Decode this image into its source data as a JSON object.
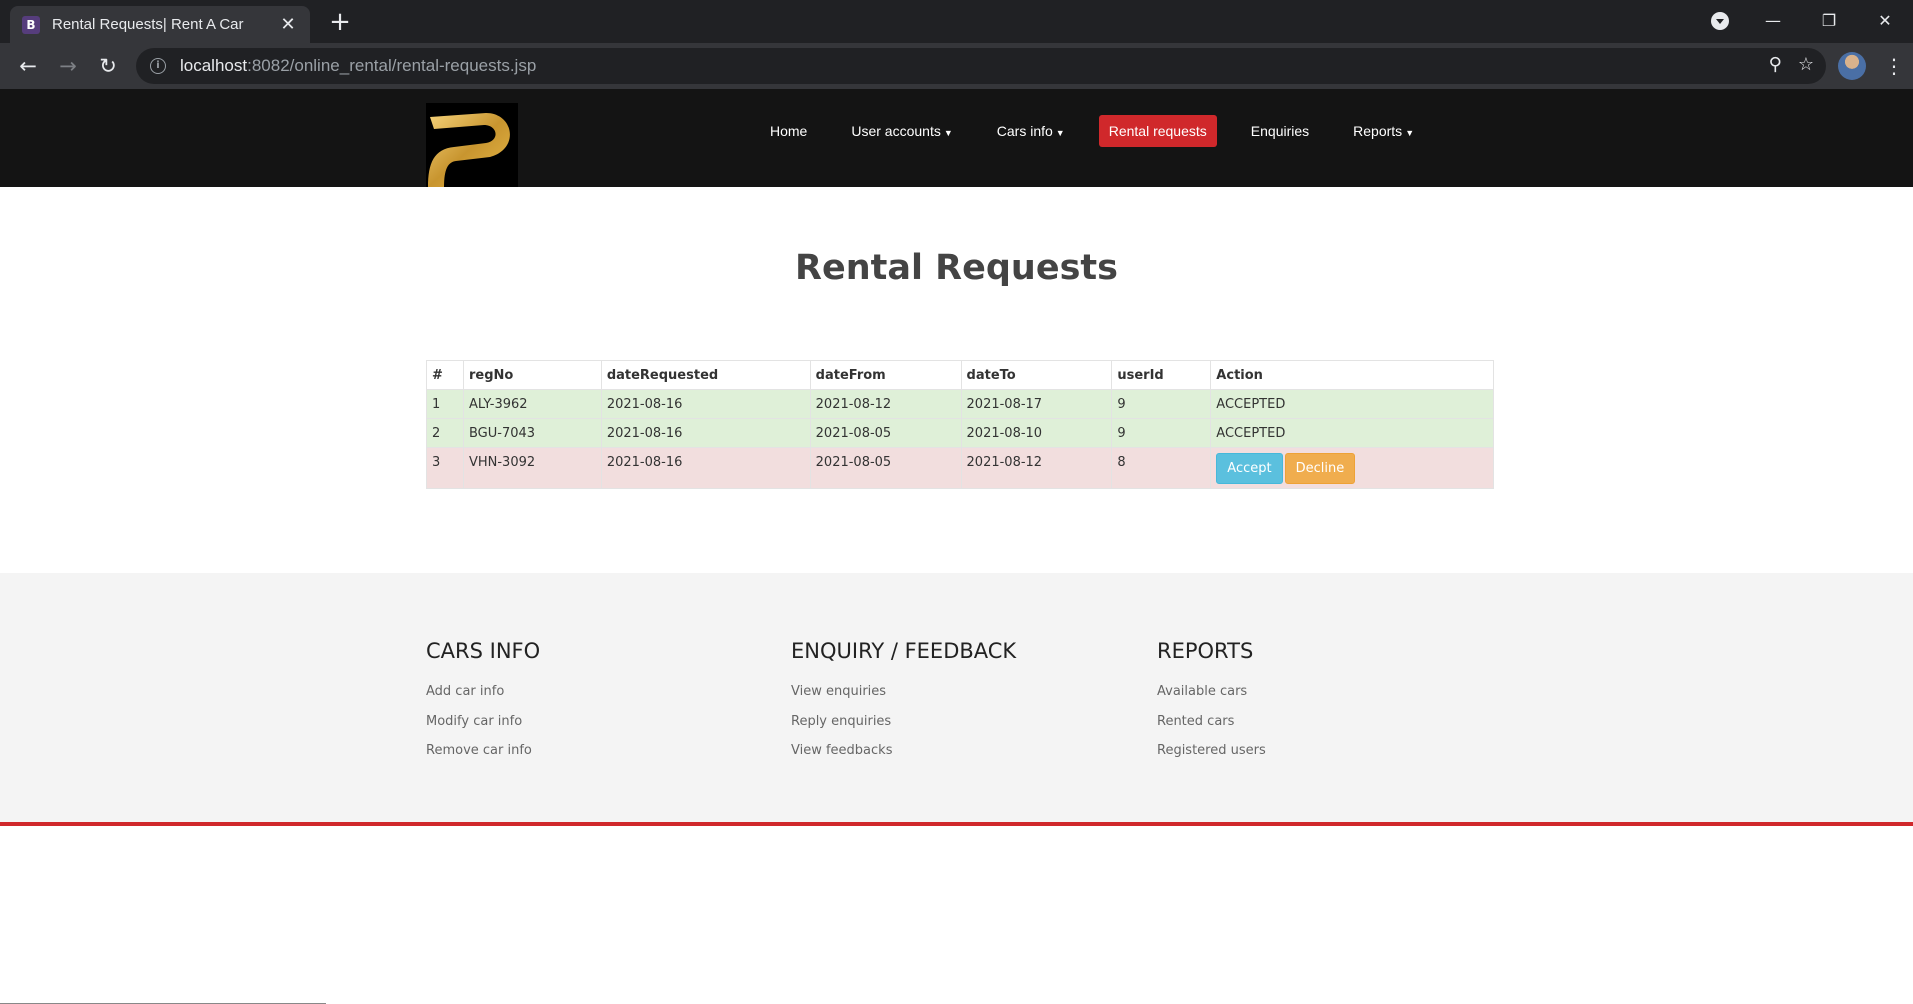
{
  "browser": {
    "tab_title": "Rental Requests| Rent A Car",
    "favicon_letter": "B",
    "url_host": "localhost",
    "url_path": ":8082/online_rental/rental-requests.jsp"
  },
  "nav": {
    "items": [
      {
        "label": "Home",
        "caret": false,
        "active": false
      },
      {
        "label": "User accounts",
        "caret": true,
        "active": false
      },
      {
        "label": "Cars info",
        "caret": true,
        "active": false
      },
      {
        "label": "Rental requests",
        "caret": false,
        "active": true
      },
      {
        "label": "Enquiries",
        "caret": false,
        "active": false
      },
      {
        "label": "Reports",
        "caret": true,
        "active": false
      }
    ]
  },
  "page": {
    "title": "Rental Requests"
  },
  "table": {
    "headers": [
      "#",
      "regNo",
      "dateRequested",
      "dateFrom",
      "dateTo",
      "userId",
      "Action"
    ],
    "rows": [
      {
        "num": "1",
        "regNo": "ALY-3962",
        "dateRequested": "2021-08-16",
        "dateFrom": "2021-08-12",
        "dateTo": "2021-08-17",
        "userId": "9",
        "action": "ACCEPTED"
      },
      {
        "num": "2",
        "regNo": "BGU-7043",
        "dateRequested": "2021-08-16",
        "dateFrom": "2021-08-05",
        "dateTo": "2021-08-10",
        "userId": "9",
        "action": "ACCEPTED"
      },
      {
        "num": "3",
        "regNo": "VHN-3092",
        "dateRequested": "2021-08-16",
        "dateFrom": "2021-08-05",
        "dateTo": "2021-08-12",
        "userId": "8",
        "action": ""
      }
    ],
    "accept_label": "Accept",
    "decline_label": "Decline"
  },
  "footer": {
    "cars_info": {
      "title": "CARS INFO",
      "links": [
        "Add car info",
        "Modify car info",
        "Remove car info"
      ]
    },
    "enquiry": {
      "title": "ENQUIRY / FEEDBACK",
      "links": [
        "View enquiries",
        "Reply enquiries",
        "View feedbacks"
      ]
    },
    "reports": {
      "title": "REPORTS",
      "links": [
        "Available cars",
        "Rented cars",
        "Registered users"
      ]
    }
  },
  "colors": {
    "brand_red": "#d0282b",
    "header_bg": "#141414",
    "success_row": "#dff0d8",
    "danger_row": "#f2dede",
    "accept_btn": "#5bc0de",
    "decline_btn": "#f0ad4e"
  }
}
